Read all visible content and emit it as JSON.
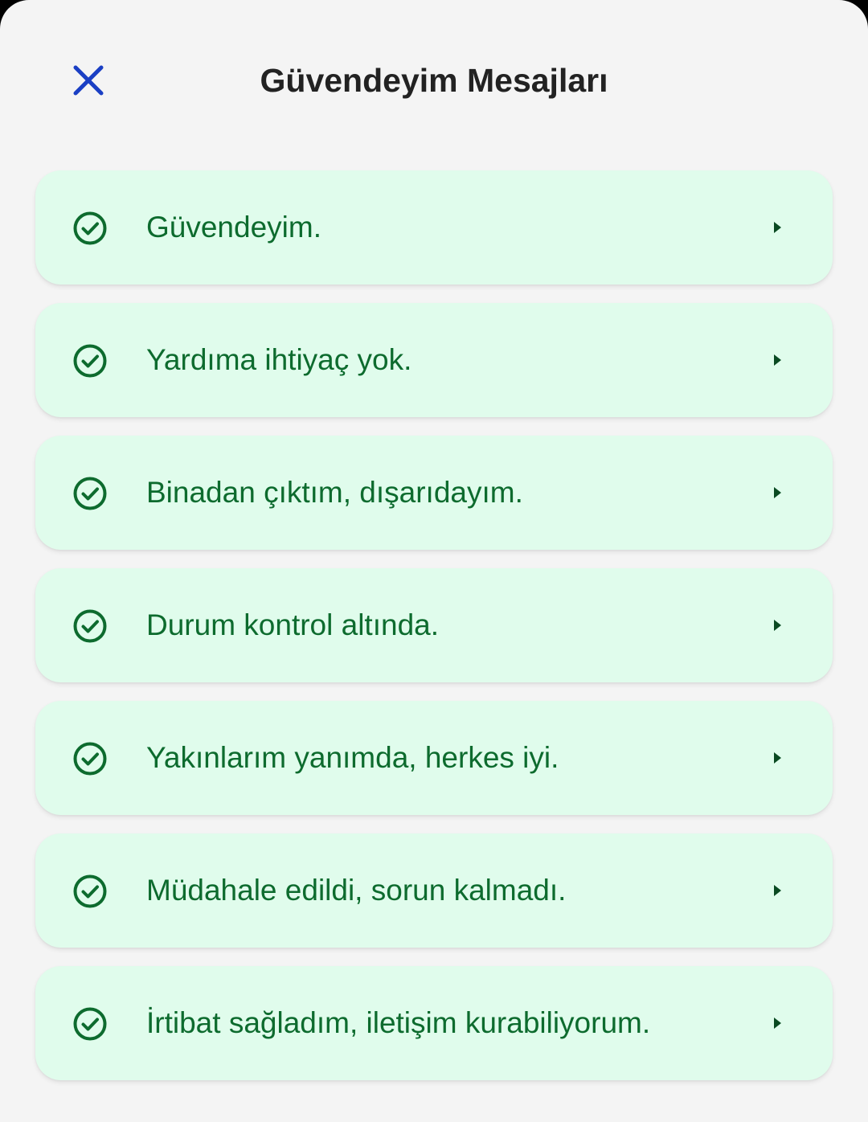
{
  "header": {
    "title": "Güvendeyim Mesajları",
    "close_icon": "close-icon"
  },
  "messages": [
    {
      "label": "Güvendeyim.",
      "icon": "check-circle-icon"
    },
    {
      "label": "Yardıma ihtiyaç yok.",
      "icon": "check-circle-icon"
    },
    {
      "label": "Binadan çıktım, dışarıdayım.",
      "icon": "check-circle-icon"
    },
    {
      "label": "Durum kontrol altında.",
      "icon": "check-circle-icon"
    },
    {
      "label": "Yakınlarım yanımda, herkes iyi.",
      "icon": "check-circle-icon"
    },
    {
      "label": "Müdahale edildi, sorun kalmadı.",
      "icon": "check-circle-icon"
    },
    {
      "label": "İrtibat sağladım, iletişim kurabiliyorum.",
      "icon": "check-circle-icon"
    }
  ],
  "colors": {
    "background": "#f4f4f4",
    "card": "#e0fcec",
    "accent_green": "#0d6b2e",
    "close_blue": "#1a3fc4",
    "title": "#222222"
  }
}
